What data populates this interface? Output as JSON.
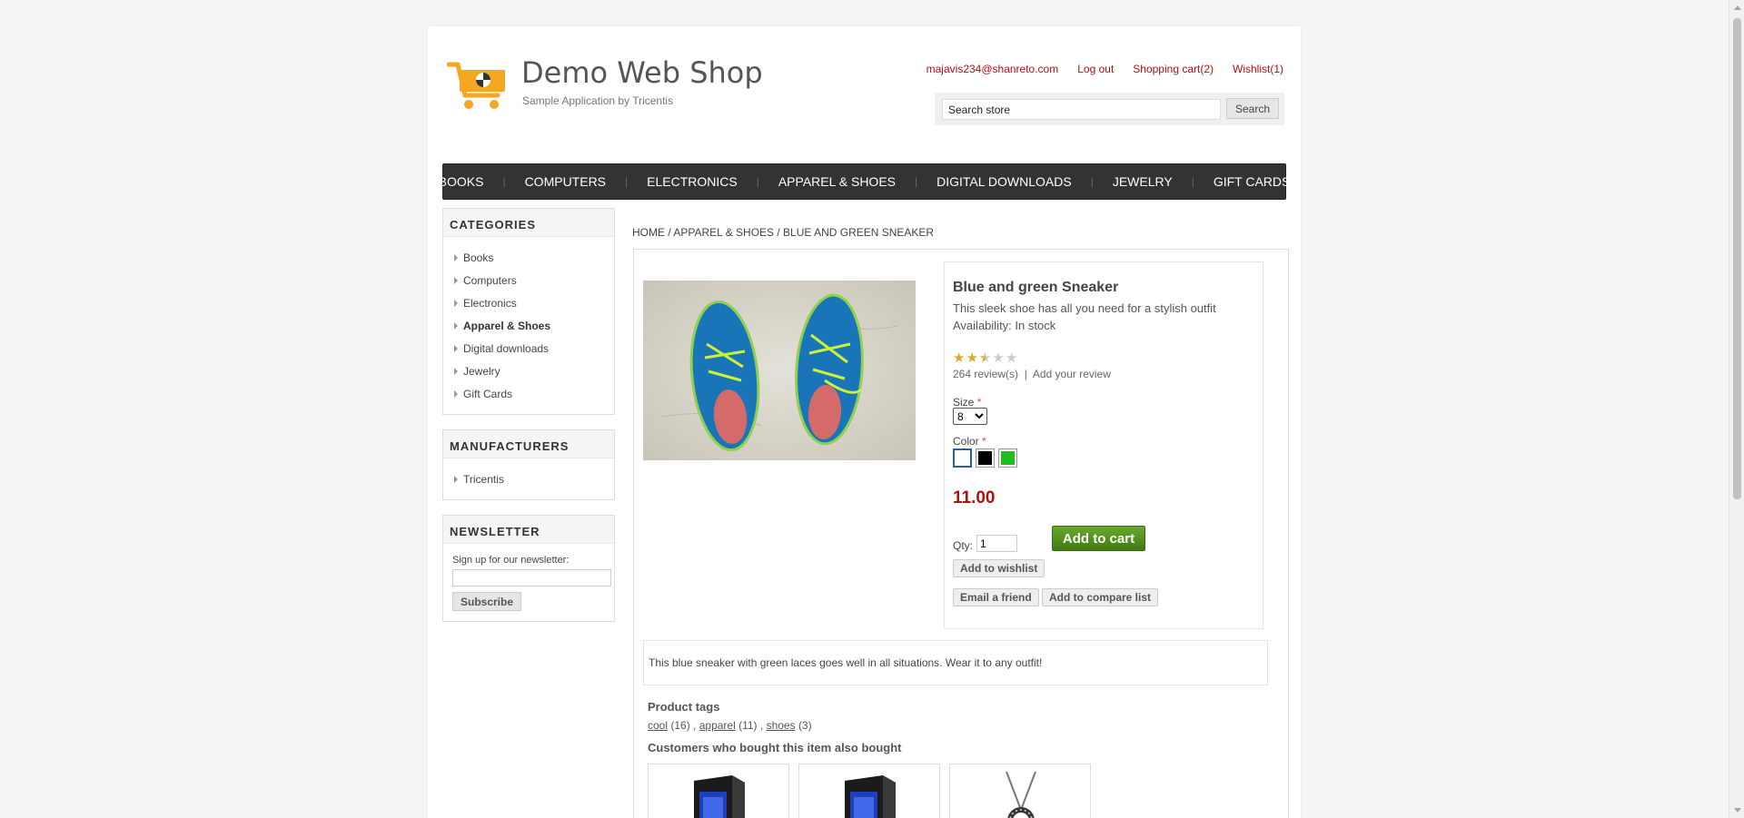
{
  "header": {
    "title": "Demo Web Shop",
    "subtitle": "Sample Application by Tricentis",
    "links": {
      "account": "majavis234@shanreto.com",
      "logout": "Log out",
      "cart": "Shopping cart(2)",
      "wishlist": "Wishlist(1)"
    },
    "search": {
      "value": "Search store",
      "button": "Search"
    }
  },
  "topnav": [
    "Books",
    "Computers",
    "Electronics",
    "Apparel & Shoes",
    "Digital downloads",
    "Jewelry",
    "Gift Cards"
  ],
  "sidebar": {
    "categories_title": "Categories",
    "categories": [
      "Books",
      "Computers",
      "Electronics",
      "Apparel & Shoes",
      "Digital downloads",
      "Jewelry",
      "Gift Cards"
    ],
    "manufacturers_title": "Manufacturers",
    "manufacturers": [
      "Tricentis"
    ],
    "newsletter_title": "Newsletter",
    "newsletter_label": "Sign up for our newsletter:",
    "subscribe": "Subscribe"
  },
  "breadcrumb": "HOME / APPAREL & SHOES / BLUE AND GREEN SNEAKER",
  "product": {
    "name": "Blue and green Sneaker",
    "short_desc": "This sleek shoe has all you need for a stylish outfit",
    "availability": "Availability: In stock",
    "rating": 2.5,
    "rating_max": 5,
    "reviews": "264 review(s)",
    "review_sep": "|",
    "add_review": "Add your review",
    "size_label": "Size",
    "size_value": "8",
    "color_label": "Color",
    "required_mark": "*",
    "colors": [
      "#ffffff",
      "#000000",
      "#1dbe1d"
    ],
    "price": "11.00",
    "qty_label": "Qty:",
    "qty_value": "1",
    "add_to_cart": "Add to cart",
    "add_to_wishlist": "Add to wishlist",
    "email_friend": "Email a friend",
    "add_compare": "Add to compare list",
    "full_desc": "This blue sneaker with green laces goes well in all situations. Wear it to any outfit!",
    "tags_title": "Product tags",
    "tags": [
      {
        "name": "cool",
        "count": "(16)"
      },
      {
        "name": "apparel",
        "count": "(11)"
      },
      {
        "name": "shoes",
        "count": "(3)"
      }
    ],
    "also_bought_title": "Customers who bought this item also bought"
  },
  "colors": {
    "accent_red": "#b00f10",
    "nav_bg": "#333333",
    "cart_green": "#4a8a1c"
  }
}
